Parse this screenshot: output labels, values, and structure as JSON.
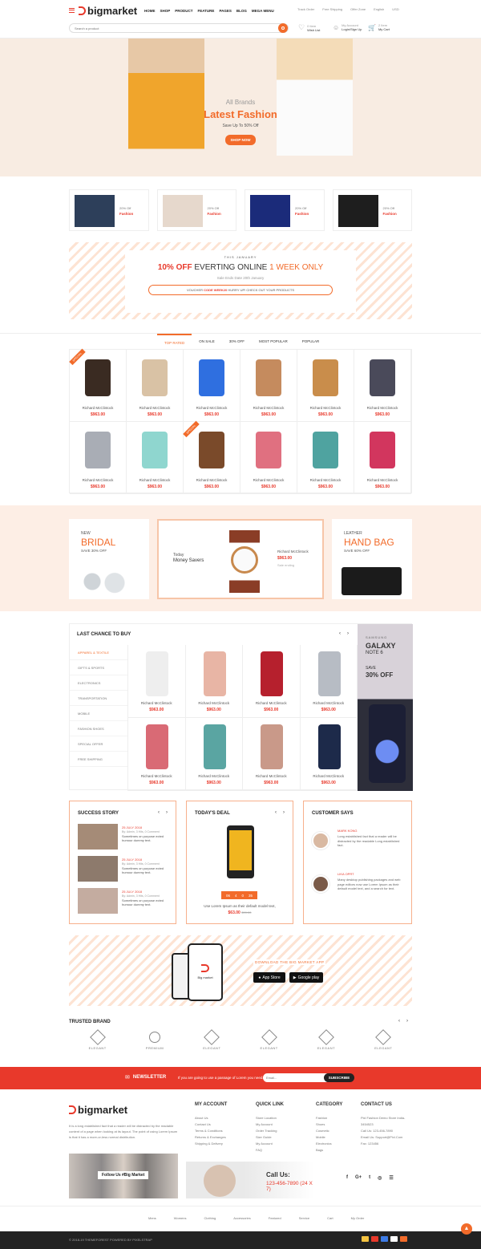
{
  "header": {
    "logo_text": "bigmarket",
    "nav": [
      "HOME",
      "SHOP",
      "PRODUCT",
      "FEATURE",
      "PAGES",
      "BLOG",
      "MEGA MENU"
    ],
    "top_links": [
      "Track Order",
      "Free Shipping",
      "Offer Zone",
      "English",
      "USD"
    ],
    "search_placeholder": "Search a product",
    "wishlist_count": "0 Item",
    "wishlist_label": "Wish List",
    "account_top": "My Account",
    "account_bottom": "Login/Sign Up",
    "cart_count": "2 Item",
    "cart_label": "My Cart"
  },
  "hero": {
    "pre": "All Brands",
    "title": "Latest Fashion",
    "sub": "Save Up To 50% Off",
    "cta": "SHOP NOW"
  },
  "promo_tiles": [
    {
      "off": "20% Off",
      "label": "Fashion"
    },
    {
      "off": "20% Off",
      "label": "Fashion"
    },
    {
      "off": "20% Off",
      "label": "Fashion"
    },
    {
      "off": "20% Off",
      "label": "Fashion"
    }
  ],
  "offer": {
    "eyebrow": "THIS JANUARY",
    "h_part1": "10% OFF",
    "h_part2": "EVERTING ONLINE",
    "h_part3": "1 WEEK ONLY",
    "date": "Sale Ends Date 20th January",
    "voucher_a": "VOUCHER",
    "voucher_b": "CODE WEEK20",
    "voucher_c": "HURRY UP! CHECK OUT YOUR PRODUCTS"
  },
  "tabs": [
    "TOP RATED",
    "ON SALE",
    "30% OFF",
    "MOST POPULAR",
    "POPULAR"
  ],
  "products": [
    {
      "name": "Richard McClintock",
      "price": "$963.00"
    },
    {
      "name": "Richard McClintock",
      "price": "$963.00"
    },
    {
      "name": "Richard McClintock",
      "price": "$963.00"
    },
    {
      "name": "Richard McClintock",
      "price": "$963.00"
    },
    {
      "name": "Richard McClintock",
      "price": "$963.00"
    },
    {
      "name": "Richard McClintock",
      "price": "$963.00"
    },
    {
      "name": "Richard McClintock",
      "price": "$963.00"
    },
    {
      "name": "Richard McClintock",
      "price": "$963.00"
    },
    {
      "name": "Richard McClintock",
      "price": "$963.00"
    },
    {
      "name": "Richard McClintock",
      "price": "$963.00"
    },
    {
      "name": "Richard McClintock",
      "price": "$963.00"
    },
    {
      "name": "Richard McClintock",
      "price": "$963.00"
    }
  ],
  "badge_special": "SPECIAL",
  "banners": {
    "bridal_new": "NEW",
    "bridal_title": "BRIDAL",
    "bridal_save": "SAVE 30% OFF",
    "mid_today": "Today",
    "mid_title": "Money Savers",
    "mid_name": "Richard McClintock",
    "mid_price": "$963.00",
    "mid_old": "Sale ending",
    "bag_leather": "LEATHER",
    "bag_title": "HAND BAG",
    "bag_save": "SAVE 60% OFF"
  },
  "last_chance": {
    "title": "LAST CHANCE TO BUY",
    "categories": [
      "APPAREL & TEXTILE",
      "GIFTS & SPORTS",
      "ELECTRONICS",
      "TRANSPORTATION",
      "MOBILE",
      "FASHION SHOES",
      "SPECIAL OFFER",
      "FREE SHIPPING"
    ],
    "items": [
      {
        "name": "Richard McClintock",
        "price": "$963.00"
      },
      {
        "name": "Richard McClintock",
        "price": "$963.00"
      },
      {
        "name": "Richard McClintock",
        "price": "$963.00"
      },
      {
        "name": "Richard McClintock",
        "price": "$963.00"
      },
      {
        "name": "Richard McClintock",
        "price": "$963.00"
      },
      {
        "name": "Richard McClintock",
        "price": "$963.00"
      },
      {
        "name": "Richard McClintock",
        "price": "$963.00"
      },
      {
        "name": "Richard McClintock",
        "price": "$963.00"
      }
    ],
    "ad_brand": "SAMSUNG",
    "ad_title1": "GALAXY",
    "ad_title2": "NOTE 6",
    "ad_save": "SAVE",
    "ad_off": "30% OFF"
  },
  "success": {
    "title": "SUCCESS STORY",
    "posts": [
      {
        "date": "25 JULY 2018",
        "meta": "By: Admin, 3 Hits, 0 Comment",
        "text": "Sometimes on purpose ected humour dummy text."
      },
      {
        "date": "25 JULY 2018",
        "meta": "By: Admin, 3 Hits, 0 Comment",
        "text": "Sometimes on purpose ected humour dummy text."
      },
      {
        "date": "25 JULY 2018",
        "meta": "By: Admin, 3 Hits, 0 Comment",
        "text": "Sometimes on purpose ected humour dummy text."
      }
    ]
  },
  "deal": {
    "title": "TODAY'S DEAL",
    "countdown": [
      "06",
      "4",
      "0",
      "35"
    ],
    "desc": "Use Lorem Ipsum as their default model text,",
    "price": "$63.00",
    "old": "$99.00"
  },
  "customers": {
    "title": "CUSTOMER SAYS",
    "items": [
      {
        "name": "MARK KONG",
        "text": "Long established fact that a reader will be distracted by the readable Long established fact."
      },
      {
        "name": "LIKA OPRT",
        "text": "Many desktop publishing packages and web page editors now use Lorem Ipsum as their default model text, and a search for text."
      }
    ]
  },
  "app": {
    "headline": "DOWNLOAD THE BIG MARKET APP",
    "appstore": "App Store",
    "gplay": "Google play",
    "phone_logo": "Big market"
  },
  "brands": {
    "title": "TRUSTED BRAND",
    "logos": [
      "ELEGANT",
      "PREMIUM",
      "ELEGANT",
      "ELEGANT",
      "ELEGANT",
      "ELEGANT"
    ]
  },
  "newsletter": {
    "title": "NEWSLETTER",
    "text": "If you are going to use a passage of Lorem you need.",
    "placeholder": "Email...",
    "button": "SUBSCRIBE"
  },
  "footer": {
    "logo": "bigmarket",
    "about": "It is a long established fact that a reader will be distracted by the readable content of a page when looking at its layout. The point of using Lorem Ipsum is that it has a more-or-less normal distribution.",
    "follow": "Follow Us #Big Market",
    "account_title": "MY ACCOUNT",
    "account_links": [
      "About Us",
      "Contact Us",
      "Terms & Conditions",
      "Returns & Exchanges",
      "Shipping & Delivery"
    ],
    "quick_title": "QUICK LINK",
    "quick_links": [
      "Store Location",
      "My Account",
      "Order Tracking",
      "Size Guide",
      "My Account",
      "FAQ"
    ],
    "cat_title": "CATEGORY",
    "cat_links": [
      "Fashion",
      "Shoes",
      "Cosmetic",
      "Mobile",
      "Electronics",
      "Bags"
    ],
    "contact_title": "CONTACT US",
    "contact": [
      "Pixl Fashion Demo Store India-3454523",
      "Call Us: 123-456-7890",
      "Email Us: Support@Pixl.Com",
      "Fax: 123456"
    ],
    "call_label": "Call Us:",
    "call_number": "123-456-7890 (24 X 7)",
    "bottom_links": [
      "Mens",
      "Womens",
      "Clothing",
      "Accessories",
      "Featured",
      "Service",
      "Cart",
      "My Order"
    ],
    "copyright": "© 2018-19 THEMEFOREST POWERED BY PIXELSTRAP"
  },
  "colors": {
    "accent": "#f26b2a",
    "red": "#e8392b",
    "peach": "#fdeee5",
    "dark": "#222222"
  }
}
